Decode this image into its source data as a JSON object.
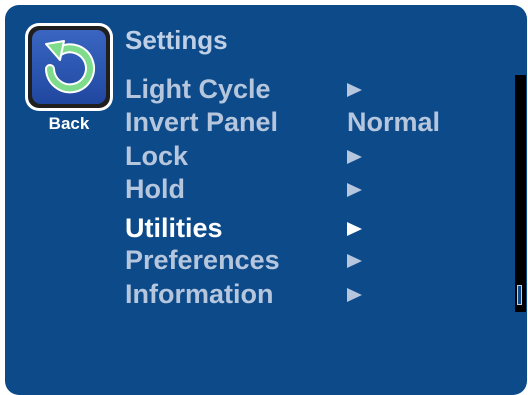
{
  "header": {
    "title": "Settings"
  },
  "back_button": {
    "label": "Back",
    "icon": "back-arrow-icon"
  },
  "menu": {
    "items": [
      {
        "label": "Light Cycle",
        "value": "",
        "has_arrow": true,
        "selected": false
      },
      {
        "label": "Invert Panel",
        "value": "Normal",
        "has_arrow": false,
        "selected": false
      },
      {
        "label": "Lock",
        "value": "",
        "has_arrow": true,
        "selected": false
      },
      {
        "label": "Hold",
        "value": "",
        "has_arrow": true,
        "selected": false
      },
      {
        "label": "Utilities",
        "value": "",
        "has_arrow": true,
        "selected": true
      },
      {
        "label": "Preferences",
        "value": "",
        "has_arrow": true,
        "selected": false
      },
      {
        "label": "Information",
        "value": "",
        "has_arrow": true,
        "selected": false
      }
    ]
  },
  "colors": {
    "background": "#0d4a8a",
    "text_normal": "#b5c6dd",
    "text_selected": "#ffffff",
    "title": "#bfd0e6"
  }
}
